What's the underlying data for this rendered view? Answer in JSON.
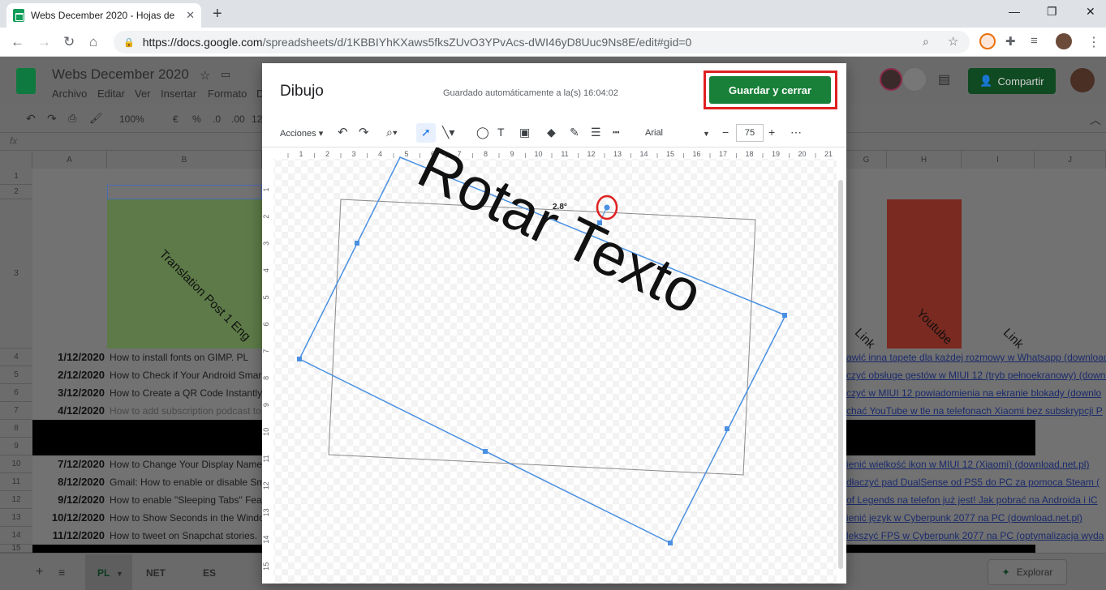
{
  "browser": {
    "tab_title": "Webs December 2020 - Hojas de",
    "url_host": "https://docs.google.com",
    "url_path": "/spreadsheets/d/1KBBIYhKXaws5fksZUvO3YPvAcs-dWI46yD8Uuc9Ns8E/edit#gid=0"
  },
  "sheets": {
    "doc_title": "Webs December 2020",
    "menu": [
      "Archivo",
      "Editar",
      "Ver",
      "Insertar",
      "Formato",
      "D"
    ],
    "share_label": "Compartir",
    "zoom": "100%",
    "currency": "€",
    "percent": "%",
    "dec1": ".0",
    "dec2": ".00",
    "num123": "12",
    "fx": "fx",
    "columns": [
      "A",
      "B",
      "G",
      "H",
      "I",
      "J"
    ],
    "header_b": "Translation Post 1 Eng",
    "header_g": "Link",
    "header_h": "Youtube",
    "header_i": "Link",
    "rows": [
      {
        "num": "1"
      },
      {
        "num": "2"
      },
      {
        "num": "3"
      },
      {
        "num": "4",
        "date": "1/12/2020",
        "text": "How to install fonts on GIMP. PL",
        "link": "awić inna tapete dla każdej rozmowy w Whatsapp (download"
      },
      {
        "num": "5",
        "date": "2/12/2020",
        "text": "How to Check if Your Android Smar",
        "link": "czyć obsługe gestów w MIUI 12 (tryb pełnoekranowy) (downlo"
      },
      {
        "num": "6",
        "date": "3/12/2020",
        "text": "How to Create a QR Code Instantly",
        "link": "czyć w MIUI 12 powiadomienia na ekranie blokady (downlo"
      },
      {
        "num": "7",
        "date": "4/12/2020",
        "text": "How to add subscription podcast to",
        "link": "chać YouTube w tle na telefonach Xiaomi bez subskrypcji P"
      },
      {
        "num": "8"
      },
      {
        "num": "9"
      },
      {
        "num": "10",
        "date": "7/12/2020",
        "text": "How to Change Your Display Name",
        "link": "ienić wielkość ikon w MIUI 12 (Xiaomi) (download.net.pl)"
      },
      {
        "num": "11",
        "date": "8/12/2020",
        "text": "Gmail: How to enable or disable Sm",
        "link": "dłaczyć pad DualSense od PS5 do PC za pomoca Steam ("
      },
      {
        "num": "12",
        "date": "9/12/2020",
        "text": "How to enable \"Sleeping Tabs\" Feat",
        "link": "of Legends na telefon już jest! Jak pobrać na Androida i iC"
      },
      {
        "num": "13",
        "date": "10/12/2020",
        "text": "How to Show Seconds in the Windo",
        "link": "ienić język w Cyberpunk 2077 na PC (download.net.pl)"
      },
      {
        "num": "14",
        "date": "11/12/2020",
        "text": "How to tweet on Snapchat stories.",
        "link": "lekszyć FPS w Cyberpunk 2077 na PC (optymalizacja wyda"
      },
      {
        "num": "15"
      }
    ],
    "sheet_tabs": [
      "PL",
      "NET",
      "ES"
    ],
    "explore_label": "Explorar"
  },
  "dialog": {
    "title": "Dibujo",
    "saved_text": "Guardado automáticamente a la(s) 16:04:02",
    "save_button": "Guardar y cerrar",
    "actions_label": "Acciones",
    "font_name": "Arial",
    "font_size": "75",
    "minus": "−",
    "plus": "+",
    "more": "⋯",
    "ruler_h": [
      "1",
      "2",
      "3",
      "4",
      "5",
      "6",
      "7",
      "8",
      "9",
      "10",
      "11",
      "12",
      "13",
      "14",
      "15",
      "16",
      "17",
      "18",
      "19",
      "20",
      "21"
    ],
    "ruler_v": [
      "1",
      "2",
      "3",
      "4",
      "5",
      "6",
      "7",
      "8",
      "9",
      "10",
      "11",
      "12",
      "13",
      "14",
      "15"
    ],
    "canvas_text": "Rotar Texto",
    "angle_label": "2.8°"
  },
  "colors": {
    "accent_green": "#188038",
    "highlight_red": "#e02020",
    "selection_blue": "#4a90e2"
  }
}
